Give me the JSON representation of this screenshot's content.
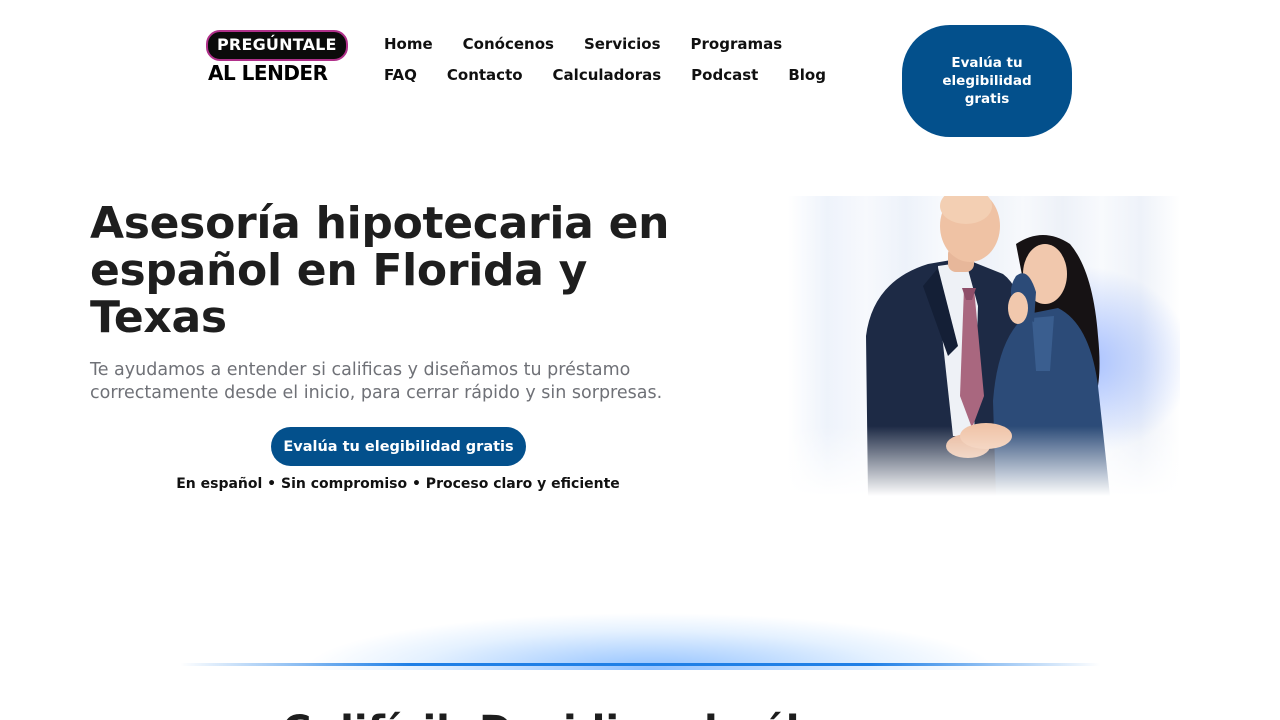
{
  "brand": {
    "logo_line1": "PREGÚNTALE",
    "logo_line2": "AL LENDER"
  },
  "nav": {
    "row1": [
      "Home",
      "Conócenos",
      "Servicios",
      "Programas"
    ],
    "row2": [
      "FAQ",
      "Contacto",
      "Calculadoras",
      "Podcast",
      "Blog"
    ]
  },
  "header": {
    "cta_label": "Evalúa tu elegibilidad gratis"
  },
  "hero": {
    "title": "Asesoría hipotecaria en español en Florida y Texas",
    "subtitle": "Te ayudamos a entender si calificas y diseñamos tu préstamo correctamente desde el inicio, para cerrar rápido y sin sorpresas.",
    "cta_label": "Evalúa tu elegibilidad gratis",
    "note": "En español • Sin compromiso • Proceso claro y eficiente"
  },
  "colors": {
    "primary": "#03508c",
    "accent_glow": "#1f7fe6",
    "logo_border": "#b0308a"
  },
  "next_section": {
    "heading_partial": "C                         difícil. Decidir sola él..."
  }
}
